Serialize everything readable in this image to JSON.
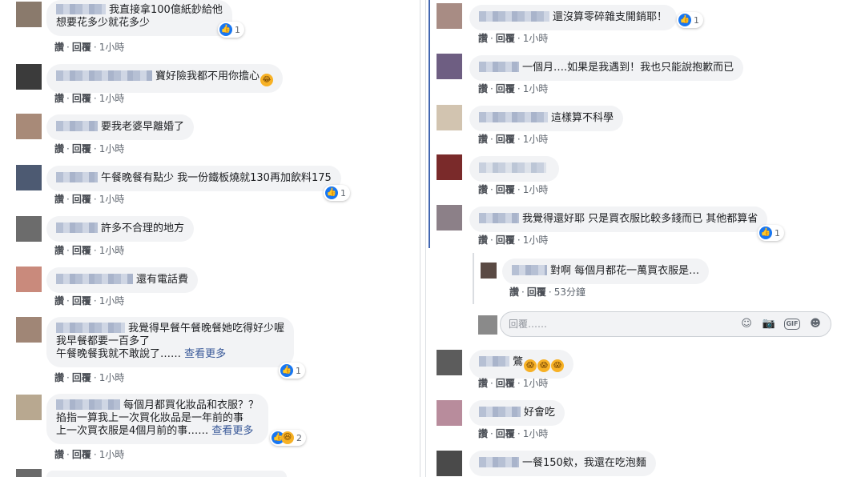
{
  "actions": {
    "like": "讚",
    "reply": "回覆",
    "sep": "·"
  },
  "colors": {
    "link": "#385898",
    "like_blue": "#1877f2",
    "bubble": "#f2f3f5"
  },
  "left_comments": [
    {
      "lines": [
        "我直接拿100億紙鈔給他",
        "想要花多少就花多少"
      ],
      "time": "1小時",
      "reaction_count": "1"
    },
    {
      "lines": [
        "寶好險我都不用你擔心"
      ],
      "emoji": [
        "haha-icon"
      ],
      "time": "1小時"
    },
    {
      "lines": [
        "要我老婆早離婚了"
      ],
      "time": "1小時"
    },
    {
      "lines": [
        "午餐晚餐有點少 我一份鐵板燒就130再加飲料175"
      ],
      "time": "1小時",
      "reaction_count": "1"
    },
    {
      "lines": [
        "許多不合理的地方"
      ],
      "time": "1小時"
    },
    {
      "lines": [
        "還有電話費"
      ],
      "time": "1小時"
    },
    {
      "lines": [
        "我覺得早餐午餐晚餐她吃得好少喔",
        "我早餐都要一百多了",
        "午餐晚餐我就不敢說了……"
      ],
      "see_more": "查看更多",
      "time": "1小時",
      "reaction_count": "1"
    },
    {
      "lines": [
        "每個月都買化妝品和衣服？？",
        "掐指一算我上一次買化妝品是一年前的事",
        "上一次買衣服是4個月前的事……"
      ],
      "see_more": "查看更多",
      "time": "1小時",
      "reaction_count": "2"
    }
  ],
  "right_comments": [
    {
      "lines": [
        "還沒算零碎雜支開銷耶！"
      ],
      "time": "1小時",
      "reaction_count": "1"
    },
    {
      "lines": [
        "一個月….如果是我遇到！我也只能說抱歉而已"
      ],
      "time": "1小時"
    },
    {
      "lines": [
        "這樣算不科學"
      ],
      "time": "1小時"
    },
    {
      "lines": [
        ""
      ],
      "time": "1小時"
    },
    {
      "lines": [
        "我覺得還好耶 只是買衣服比較多錢而已 其他都算省"
      ],
      "time": "1小時",
      "reaction_count": "1"
    },
    {
      "lines": [
        "對啊 每個月都花一萬買衣服是…"
      ],
      "time": "53分鐘"
    },
    {
      "lines": [
        "鷩"
      ],
      "emoji": [
        "scream-icon",
        "scream-icon",
        "scream-icon"
      ],
      "time": "1小時"
    },
    {
      "lines": [
        "好會吃"
      ],
      "time": "1小時"
    },
    {
      "lines": [
        "一餐150欸，我還在吃泡麵"
      ],
      "time": ""
    }
  ],
  "reply_box": {
    "placeholder": "回覆……"
  }
}
